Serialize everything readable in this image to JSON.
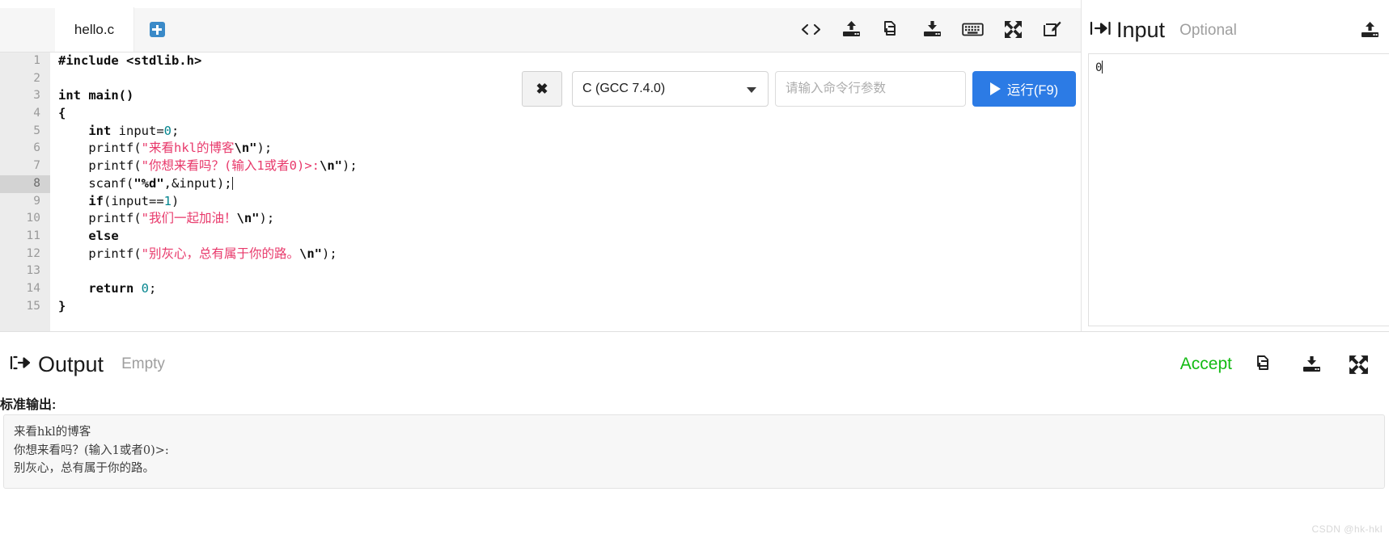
{
  "editor": {
    "tabs": [
      {
        "label": "hello.c",
        "active": true
      }
    ],
    "new_tab_icon": "plus-square-icon",
    "toolbar": [
      {
        "name": "code-icon",
        "glyph": "</>"
      },
      {
        "name": "upload-icon",
        "glyph": "upload"
      },
      {
        "name": "copy-icon",
        "glyph": "copy"
      },
      {
        "name": "download-icon",
        "glyph": "download"
      },
      {
        "name": "keyboard-icon",
        "glyph": "keyboard"
      },
      {
        "name": "fullscreen-icon",
        "glyph": "expand"
      },
      {
        "name": "edit-icon",
        "glyph": "pencil-square"
      }
    ],
    "active_line": 8,
    "lines": [
      {
        "n": 1,
        "tokens": [
          {
            "t": "#include <stdlib.h>",
            "c": "kw"
          }
        ]
      },
      {
        "n": 2,
        "tokens": []
      },
      {
        "n": 3,
        "tokens": [
          {
            "t": "int main()",
            "c": "kw"
          }
        ]
      },
      {
        "n": 4,
        "tokens": [
          {
            "t": "{",
            "c": "kw"
          }
        ]
      },
      {
        "n": 5,
        "tokens": [
          {
            "t": "    int",
            "c": "kw"
          },
          {
            "t": " input=",
            "c": "pln"
          },
          {
            "t": "0",
            "c": "num"
          },
          {
            "t": ";",
            "c": "pln"
          }
        ]
      },
      {
        "n": 6,
        "tokens": [
          {
            "t": "    printf(",
            "c": "pln"
          },
          {
            "t": "\"来看hkl的博客",
            "c": "str"
          },
          {
            "t": "\\n\"",
            "c": "kw"
          },
          {
            "t": ");",
            "c": "pln"
          }
        ]
      },
      {
        "n": 7,
        "tokens": [
          {
            "t": "    printf(",
            "c": "pln"
          },
          {
            "t": "\"你想来看吗？(输入1或者0)>:",
            "c": "str"
          },
          {
            "t": "\\n\"",
            "c": "kw"
          },
          {
            "t": ");",
            "c": "pln"
          }
        ]
      },
      {
        "n": 8,
        "tokens": [
          {
            "t": "    scanf(",
            "c": "pln"
          },
          {
            "t": "\"%d\"",
            "c": "kw"
          },
          {
            "t": ",&input);",
            "c": "pln"
          }
        ],
        "caret": true
      },
      {
        "n": 9,
        "tokens": [
          {
            "t": "    if",
            "c": "kw"
          },
          {
            "t": "(input==",
            "c": "pln"
          },
          {
            "t": "1",
            "c": "num"
          },
          {
            "t": ")",
            "c": "pln"
          }
        ]
      },
      {
        "n": 10,
        "tokens": [
          {
            "t": "    printf(",
            "c": "pln"
          },
          {
            "t": "\"我们一起加油！",
            "c": "str"
          },
          {
            "t": "\\n\"",
            "c": "kw"
          },
          {
            "t": ");",
            "c": "pln"
          }
        ]
      },
      {
        "n": 11,
        "tokens": [
          {
            "t": "    else",
            "c": "kw"
          }
        ]
      },
      {
        "n": 12,
        "tokens": [
          {
            "t": "    printf(",
            "c": "pln"
          },
          {
            "t": "\"别灰心，总有属于你的路。",
            "c": "str"
          },
          {
            "t": "\\n\"",
            "c": "kw"
          },
          {
            "t": ");",
            "c": "pln"
          }
        ]
      },
      {
        "n": 13,
        "tokens": []
      },
      {
        "n": 14,
        "tokens": [
          {
            "t": "    return",
            "c": "kw"
          },
          {
            "t": " ",
            "c": "pln"
          },
          {
            "t": "0",
            "c": "num"
          },
          {
            "t": ";",
            "c": "pln"
          }
        ]
      },
      {
        "n": 15,
        "tokens": [
          {
            "t": "}",
            "c": "kw"
          }
        ]
      }
    ]
  },
  "runbar": {
    "close_label": "✖",
    "language": "C (GCC 7.4.0)",
    "args_value": "",
    "args_placeholder": "请输入命令行参数",
    "run_label": "运行(F9)"
  },
  "input_panel": {
    "title": "Input",
    "status": "Optional",
    "value": "0",
    "upload_icon": "upload-icon"
  },
  "output_panel": {
    "title": "Output",
    "status": "Empty",
    "accept_label": "Accept",
    "stdout_label": "标准输出:",
    "stdout_lines": [
      "来看hkl的博客",
      "你想来看吗？(输入1或者0)>:",
      "别灰心，总有属于你的路。"
    ],
    "actions": [
      {
        "name": "copy-icon"
      },
      {
        "name": "download-icon"
      },
      {
        "name": "fullscreen-icon"
      }
    ]
  },
  "watermark": "CSDN @hk-hkl",
  "colors": {
    "accent_blue": "#2c7be5",
    "accept_green": "#13bb13",
    "string_pink": "#e8396b",
    "number_teal": "#06868f",
    "gutter_bg": "#ececec"
  }
}
